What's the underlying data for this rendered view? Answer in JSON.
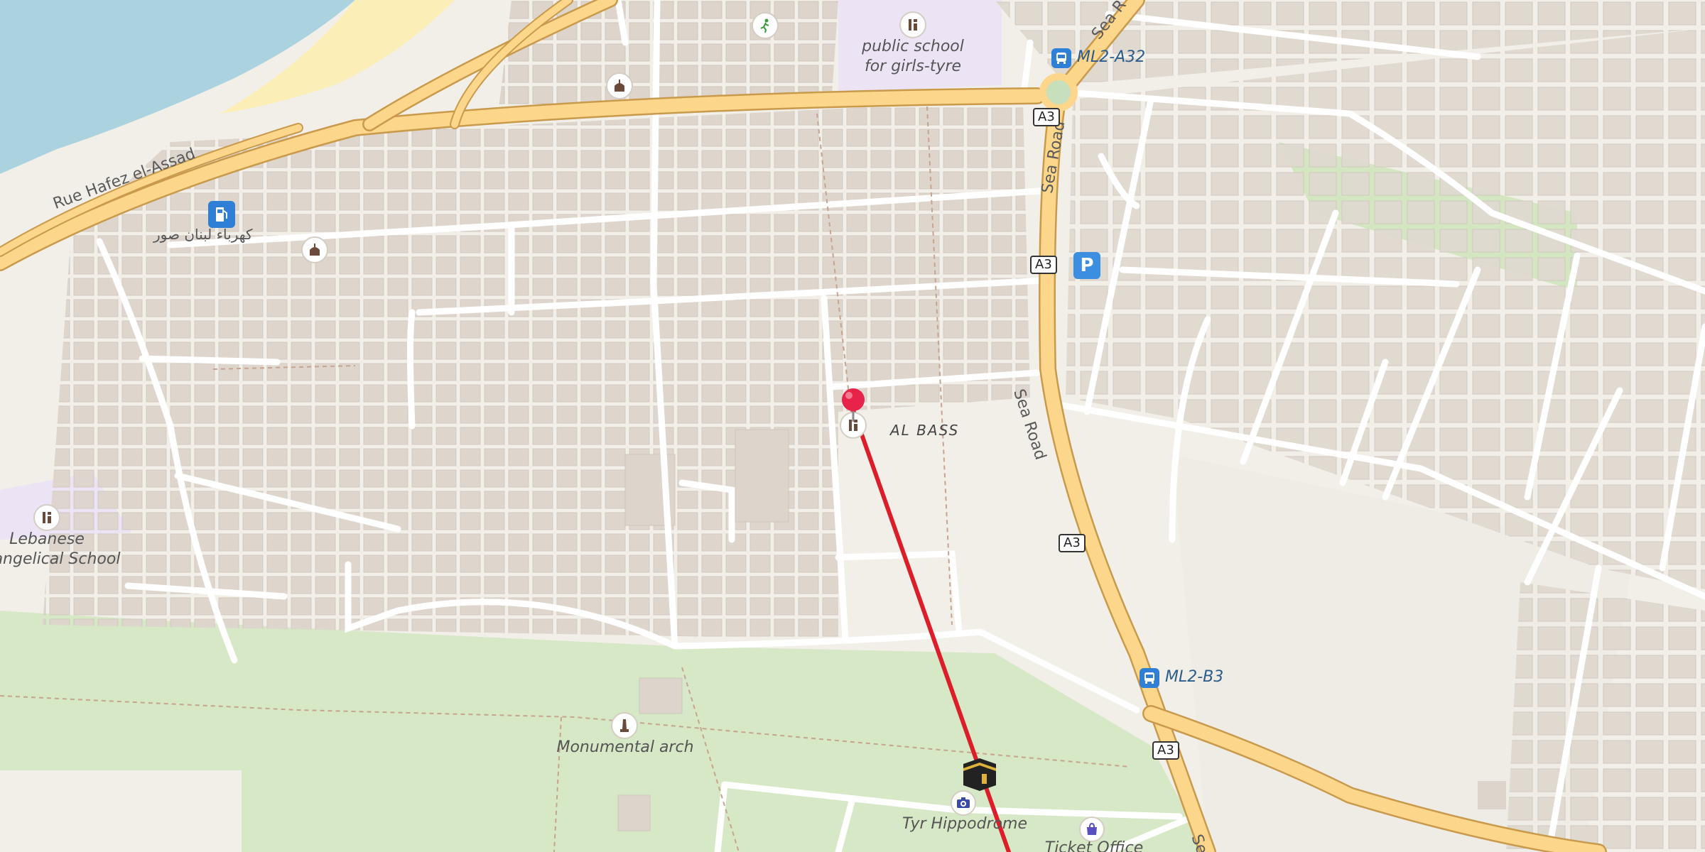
{
  "map": {
    "labels": {
      "public_school_line1": "public school",
      "public_school_line2": "for girls-tyre",
      "al_bass": "AL BASS",
      "lebanese_line1": "Lebanese",
      "lebanese_line2": "angelical School",
      "monumental_arch": "Monumental arch",
      "tyr_hippodrome": "Tyr Hippodrome",
      "ticket_office": "Ticket Office",
      "arabic_station": "كهرباء لبنان صور"
    },
    "roads": {
      "rue_hafez": "Rue Hafez el-Assad",
      "sea_road": "Sea Road",
      "sea_road_top": "Sea R",
      "sea_road_bottom": "Se"
    },
    "shields": [
      "A3",
      "A3",
      "A3",
      "A3"
    ],
    "bus_stops": [
      "ML2-A32",
      "ML2-B3"
    ],
    "icons": {
      "fuel": "fuel-station-icon",
      "parking": "parking-icon",
      "school": "school-icon",
      "place_of_worship": "place-of-worship-icon",
      "monument": "monument-icon",
      "sports": "sports-icon",
      "camera": "viewpoint-camera-icon",
      "shop": "shop-bag-icon",
      "kaaba": "kaaba-icon",
      "pin": "location-pin-icon",
      "bus": "bus-stop-icon"
    },
    "colors": {
      "background": "#f2efe9",
      "water": "#aad3df",
      "beach": "#fbeeb6",
      "park": "#d7e8c6",
      "building": "#e0d9d0",
      "major_road": "#fcd68a",
      "route_line": "#dc1e2b",
      "pin": "#e8234a",
      "school_area": "#ece4f5"
    }
  }
}
